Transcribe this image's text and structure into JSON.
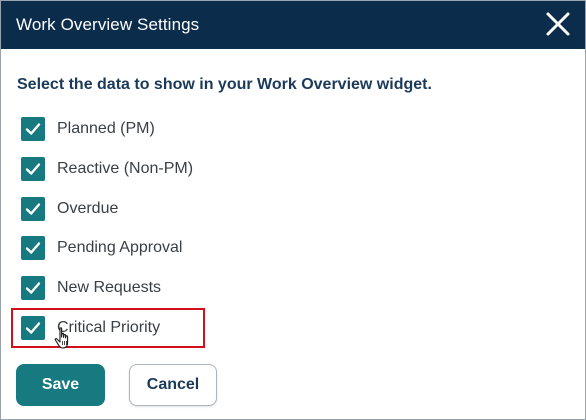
{
  "dialog": {
    "title": "Work Overview Settings",
    "close_icon": "close-icon",
    "instruction": "Select the data to show in your Work Overview widget.",
    "options": [
      {
        "label": "Planned (PM)",
        "checked": true
      },
      {
        "label": "Reactive (Non-PM)",
        "checked": true
      },
      {
        "label": "Overdue",
        "checked": true
      },
      {
        "label": "Pending Approval",
        "checked": true
      },
      {
        "label": "New Requests",
        "checked": true
      },
      {
        "label": "Critical Priority",
        "checked": true
      }
    ],
    "save_label": "Save",
    "cancel_label": "Cancel"
  },
  "colors": {
    "header_bg": "#0c2c4c",
    "accent": "#167a80",
    "highlight": "#d40f1c"
  }
}
